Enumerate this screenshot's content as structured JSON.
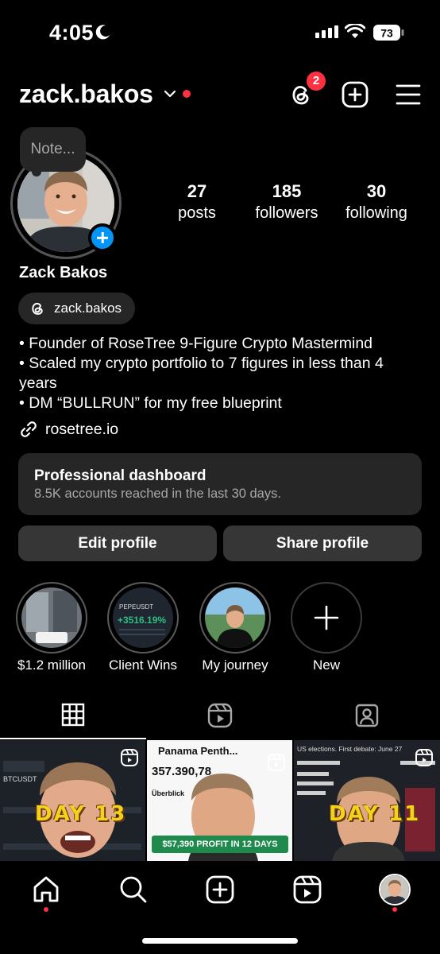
{
  "status_bar": {
    "time": "4:05",
    "battery": "73"
  },
  "header": {
    "username": "zack.bakos",
    "threads_badge": "2"
  },
  "note": {
    "placeholder": "Note..."
  },
  "stats": [
    {
      "value": "27",
      "label": "posts"
    },
    {
      "value": "185",
      "label": "followers"
    },
    {
      "value": "30",
      "label": "following"
    }
  ],
  "profile": {
    "name": "Zack Bakos",
    "threads_handle": "zack.bakos",
    "bio_lines": [
      "• Founder of RoseTree 9-Figure Crypto Mastermind",
      "• Scaled my crypto portfolio to 7 figures in less than 4 years",
      "• DM “BULLRUN” for my free blueprint"
    ],
    "link": "rosetree.io"
  },
  "dashboard": {
    "title": "Professional dashboard",
    "subtitle": "8.5K accounts reached in the last 30 days."
  },
  "buttons": {
    "edit": "Edit profile",
    "share": "Share profile"
  },
  "highlights": [
    {
      "label": "$1.2 million"
    },
    {
      "label": "Client Wins"
    },
    {
      "label": "My journey"
    },
    {
      "label": "New"
    }
  ],
  "highlight_content": {
    "client_wins_ticker": "PEPEUSDT",
    "client_wins_value": "+3516.19%"
  },
  "posts": [
    {
      "caption": "DAY 13",
      "ticker": "BTCUSDT"
    },
    {
      "caption": "$57,390 PROFIT IN 12 DAYS",
      "header": "Panama Penth...",
      "amount": "357.390,78",
      "tab": "Überblick"
    },
    {
      "caption": "DAY 11",
      "header": "US elections. First debate: June 27"
    }
  ],
  "colors": {
    "accent": "#0095f6",
    "notification": "#ff3040",
    "surface": "#262626",
    "button": "#363636"
  }
}
